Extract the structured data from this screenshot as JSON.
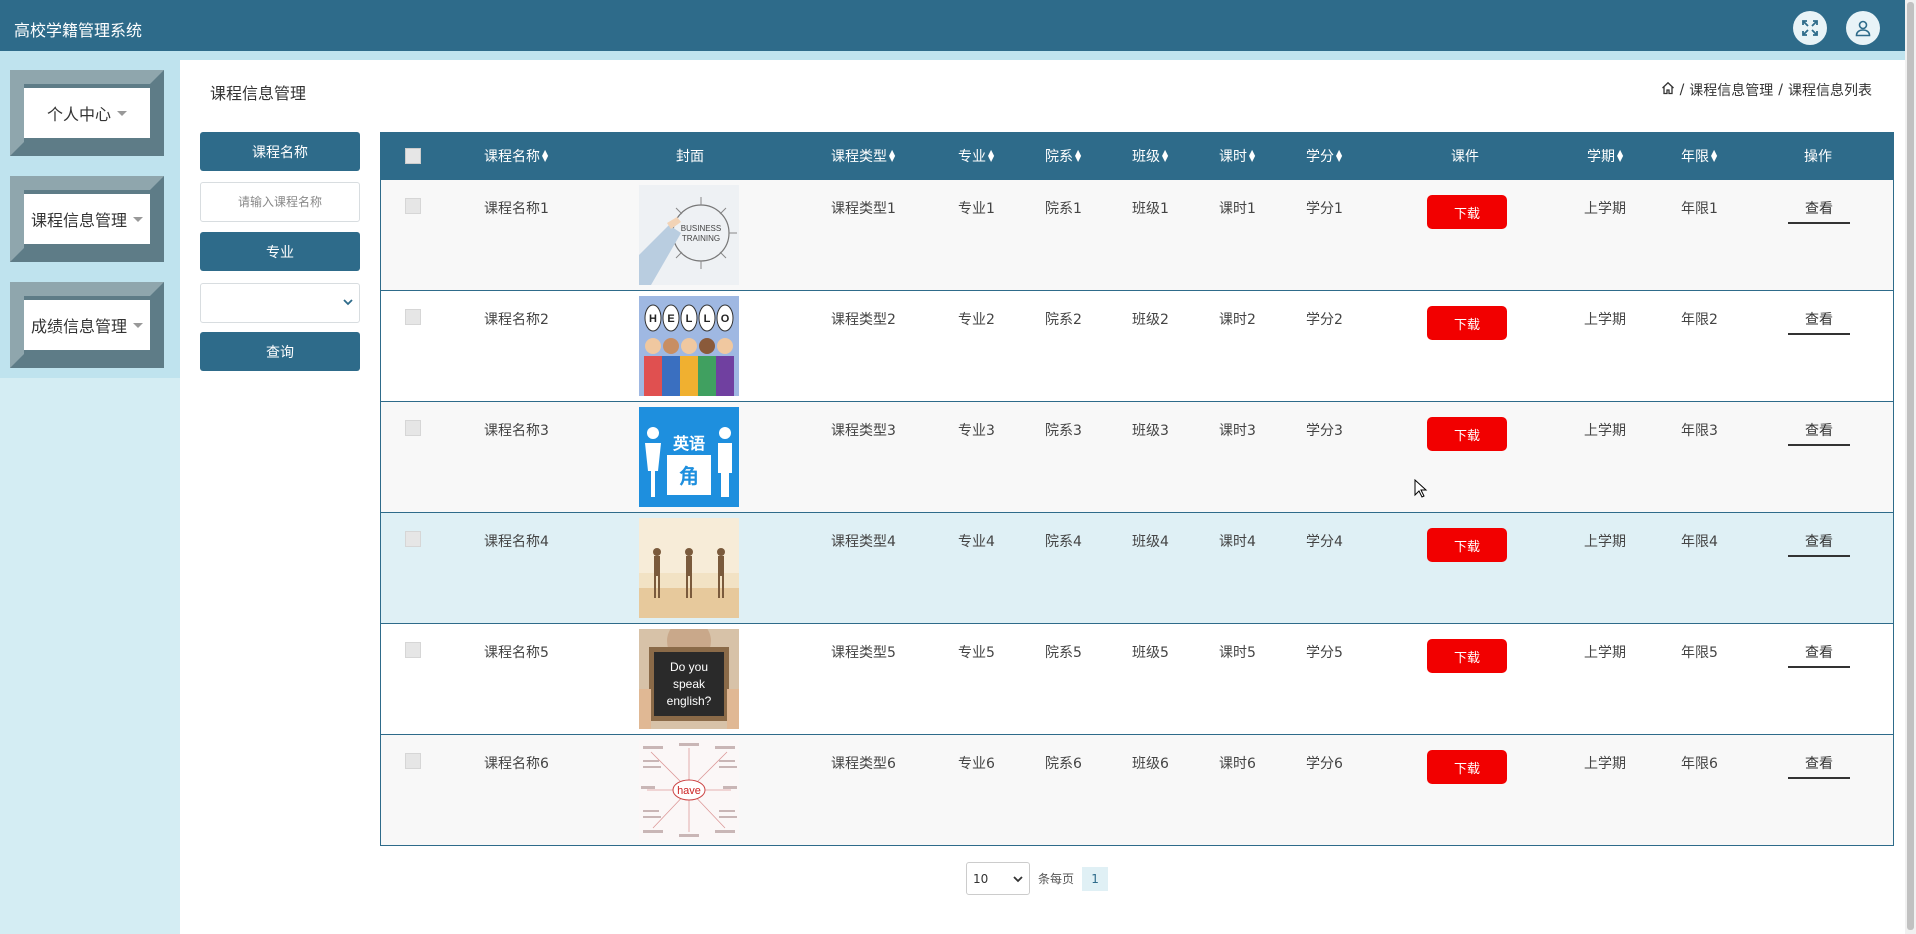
{
  "header": {
    "title": "高校学籍管理系统",
    "icons": [
      "fullscreen-icon",
      "user-icon"
    ]
  },
  "sidebar": {
    "items": [
      {
        "label": "个人中心"
      },
      {
        "label": "课程信息管理"
      },
      {
        "label": "成绩信息管理"
      }
    ]
  },
  "page": {
    "title": "课程信息管理"
  },
  "breadcrumb": {
    "items": [
      "课程信息管理",
      "课程信息列表"
    ],
    "separator": "/"
  },
  "filters": {
    "name_label": "课程名称",
    "name_placeholder": "请输入课程名称",
    "major_label": "专业",
    "major_value": "",
    "query_label": "查询"
  },
  "table": {
    "columns": [
      "课程名称",
      "封面",
      "课程类型",
      "专业",
      "院系",
      "班级",
      "课时",
      "学分",
      "课件",
      "学期",
      "年限",
      "操作"
    ],
    "download_label": "下载",
    "view_label": "查看",
    "rows": [
      {
        "name": "课程名称1",
        "cover": "business-training-image",
        "type": "课程类型1",
        "major": "专业1",
        "dept": "院系1",
        "class": "班级1",
        "hours": "课时1",
        "credit": "学分1",
        "term": "上学期",
        "years": "年限1"
      },
      {
        "name": "课程名称2",
        "cover": "hello-people-image",
        "type": "课程类型2",
        "major": "专业2",
        "dept": "院系2",
        "class": "班级2",
        "hours": "课时2",
        "credit": "学分2",
        "term": "上学期",
        "years": "年限2"
      },
      {
        "name": "课程名称3",
        "cover": "english-corner-sign-image",
        "cover_text": [
          "英语",
          "角"
        ],
        "type": "课程类型3",
        "major": "专业3",
        "dept": "院系3",
        "class": "班级3",
        "hours": "课时3",
        "credit": "学分3",
        "term": "上学期",
        "years": "年限3"
      },
      {
        "name": "课程名称4",
        "cover": "dancers-image",
        "type": "课程类型4",
        "major": "专业4",
        "dept": "院系4",
        "class": "班级4",
        "hours": "课时4",
        "credit": "学分4",
        "term": "上学期",
        "years": "年限4"
      },
      {
        "name": "课程名称5",
        "cover": "do-you-speak-english-sign-image",
        "cover_text": [
          "Do you",
          "speak",
          "english?"
        ],
        "type": "课程类型5",
        "major": "专业5",
        "dept": "院系5",
        "class": "班级5",
        "hours": "课时5",
        "credit": "学分5",
        "term": "上学期",
        "years": "年限5"
      },
      {
        "name": "课程名称6",
        "cover": "have-wordmap-image",
        "cover_text": [
          "have"
        ],
        "type": "课程类型6",
        "major": "专业6",
        "dept": "院系6",
        "class": "班级6",
        "hours": "课时6",
        "credit": "学分6",
        "term": "上学期",
        "years": "年限6"
      }
    ]
  },
  "pagination": {
    "page_size": "10",
    "per_page_label": "条每页",
    "current_page": "1"
  },
  "colors": {
    "primary": "#2e6b8a",
    "download": "#f20000",
    "highlight_row": "#dff0f5"
  }
}
